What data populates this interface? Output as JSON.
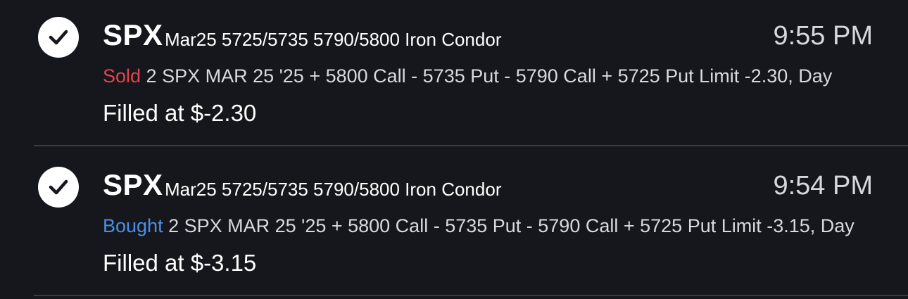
{
  "orders": [
    {
      "symbol": "SPX",
      "strategy": "Mar25 5725/5735 5790/5800 Iron Condor",
      "time": "9:55 PM",
      "side": "Sold",
      "description": " 2 SPX MAR 25 '25 + 5800 Call - 5735 Put - 5790 Call + 5725 Put Limit -2.30, Day",
      "fill": "Filled at $-2.30",
      "status_icon": "checkmark-icon"
    },
    {
      "symbol": "SPX",
      "strategy": "Mar25 5725/5735 5790/5800 Iron Condor",
      "time": "9:54 PM",
      "side": "Bought",
      "description": " 2 SPX MAR 25 '25 + 5800 Call - 5735 Put - 5790 Call + 5725 Put Limit -3.15, Day",
      "fill": "Filled at $-3.15",
      "status_icon": "checkmark-icon"
    }
  ],
  "colors": {
    "background": "#15171d",
    "sold": "#e5434d",
    "bought": "#4d8fe6",
    "divider": "#3a3c43"
  }
}
